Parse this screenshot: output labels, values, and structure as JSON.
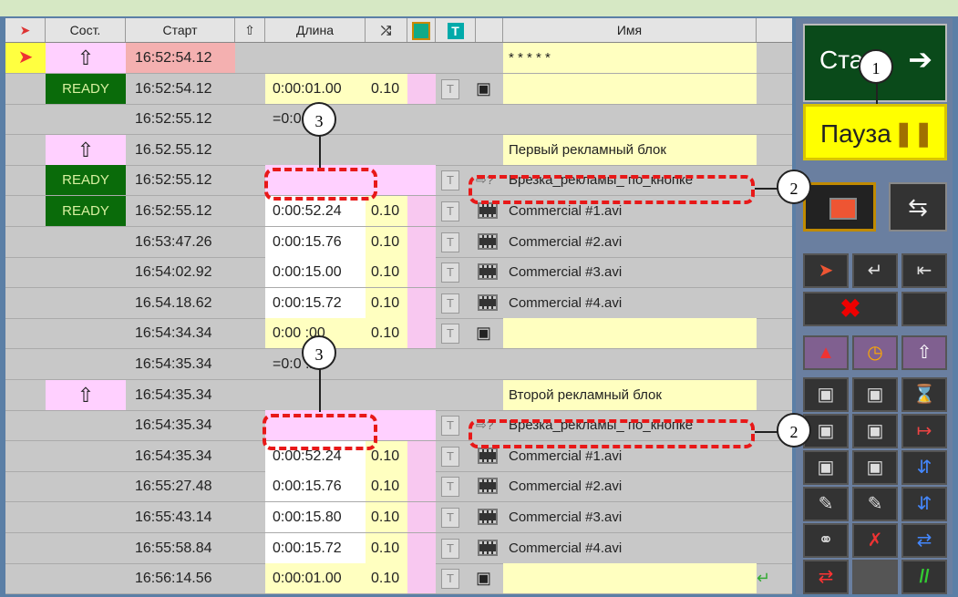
{
  "header": {
    "state_label": "Сост.",
    "start_label": "Старт",
    "duration_label": "Длина",
    "name_label": "Имя"
  },
  "rows": [
    {
      "state": "",
      "start": "16:52:54.12",
      "duration": "",
      "tr": "",
      "name": "* * * * *"
    },
    {
      "state": "READY",
      "start": "16:52:54.12",
      "duration": "0:00:01.00",
      "tr": "0.10",
      "name": ""
    },
    {
      "state": "",
      "start": "16:52:55.12",
      "duration": "=0:0   :00",
      "tr": "",
      "name": ""
    },
    {
      "state": "",
      "start": "16.52.55.12",
      "duration": "",
      "tr": "",
      "name": "Первый рекламный блок"
    },
    {
      "state": "READY",
      "start": "16:52:55.12",
      "duration": "",
      "tr": "",
      "name": "Врезка_рекламы_ по_кнопке"
    },
    {
      "state": "READY",
      "start": "16:52:55.12",
      "duration": "0:00:52.24",
      "tr": "0.10",
      "name": "Commercial #1.avi"
    },
    {
      "state": "",
      "start": "16:53:47.26",
      "duration": "0:00:15.76",
      "tr": "0.10",
      "name": "Commercial #2.avi"
    },
    {
      "state": "",
      "start": "16:54:02.92",
      "duration": "0:00:15.00",
      "tr": "0.10",
      "name": "Commercial #3.avi"
    },
    {
      "state": "",
      "start": "16.54.18.62",
      "duration": "0:00:15.72",
      "tr": "0.10",
      "name": "Commercial #4.avi"
    },
    {
      "state": "",
      "start": "16:54:34.34",
      "duration": "0:00   :00",
      "tr": "0.10",
      "name": ""
    },
    {
      "state": "",
      "start": "16:54:35.34",
      "duration": "=0:0   :22",
      "tr": "",
      "name": ""
    },
    {
      "state": "",
      "start": "16:54:35.34",
      "duration": "",
      "tr": "",
      "name": "Второй рекламный блок"
    },
    {
      "state": "",
      "start": "16:54:35.34",
      "duration": "",
      "tr": "",
      "name": "Врезка_рекламы_ по_кнопке"
    },
    {
      "state": "",
      "start": "16:54:35.34",
      "duration": "0:00:52.24",
      "tr": "0.10",
      "name": "Commercial #1.avi"
    },
    {
      "state": "",
      "start": "16:55:27.48",
      "duration": "0:00:15.76",
      "tr": "0.10",
      "name": "Commercial #2.avi"
    },
    {
      "state": "",
      "start": "16:55:43.14",
      "duration": "0:00:15.80",
      "tr": "0.10",
      "name": "Commercial #3.avi"
    },
    {
      "state": "",
      "start": "16:55:58.84",
      "duration": "0:00:15.72",
      "tr": "0.10",
      "name": "Commercial #4.avi"
    },
    {
      "state": "",
      "start": "16:56:14.56",
      "duration": "0:00:01.00",
      "tr": "0.10",
      "name": ""
    }
  ],
  "side": {
    "start_label": "Ста",
    "pause_label": "Пауза"
  },
  "callouts": {
    "one": "1",
    "two": "2",
    "three": "3"
  },
  "colors": {
    "pause_yellow": "#ffff00",
    "start_green": "#0a5a1a",
    "ready_green": "#0a6b0a",
    "dash_red": "#e81818"
  }
}
